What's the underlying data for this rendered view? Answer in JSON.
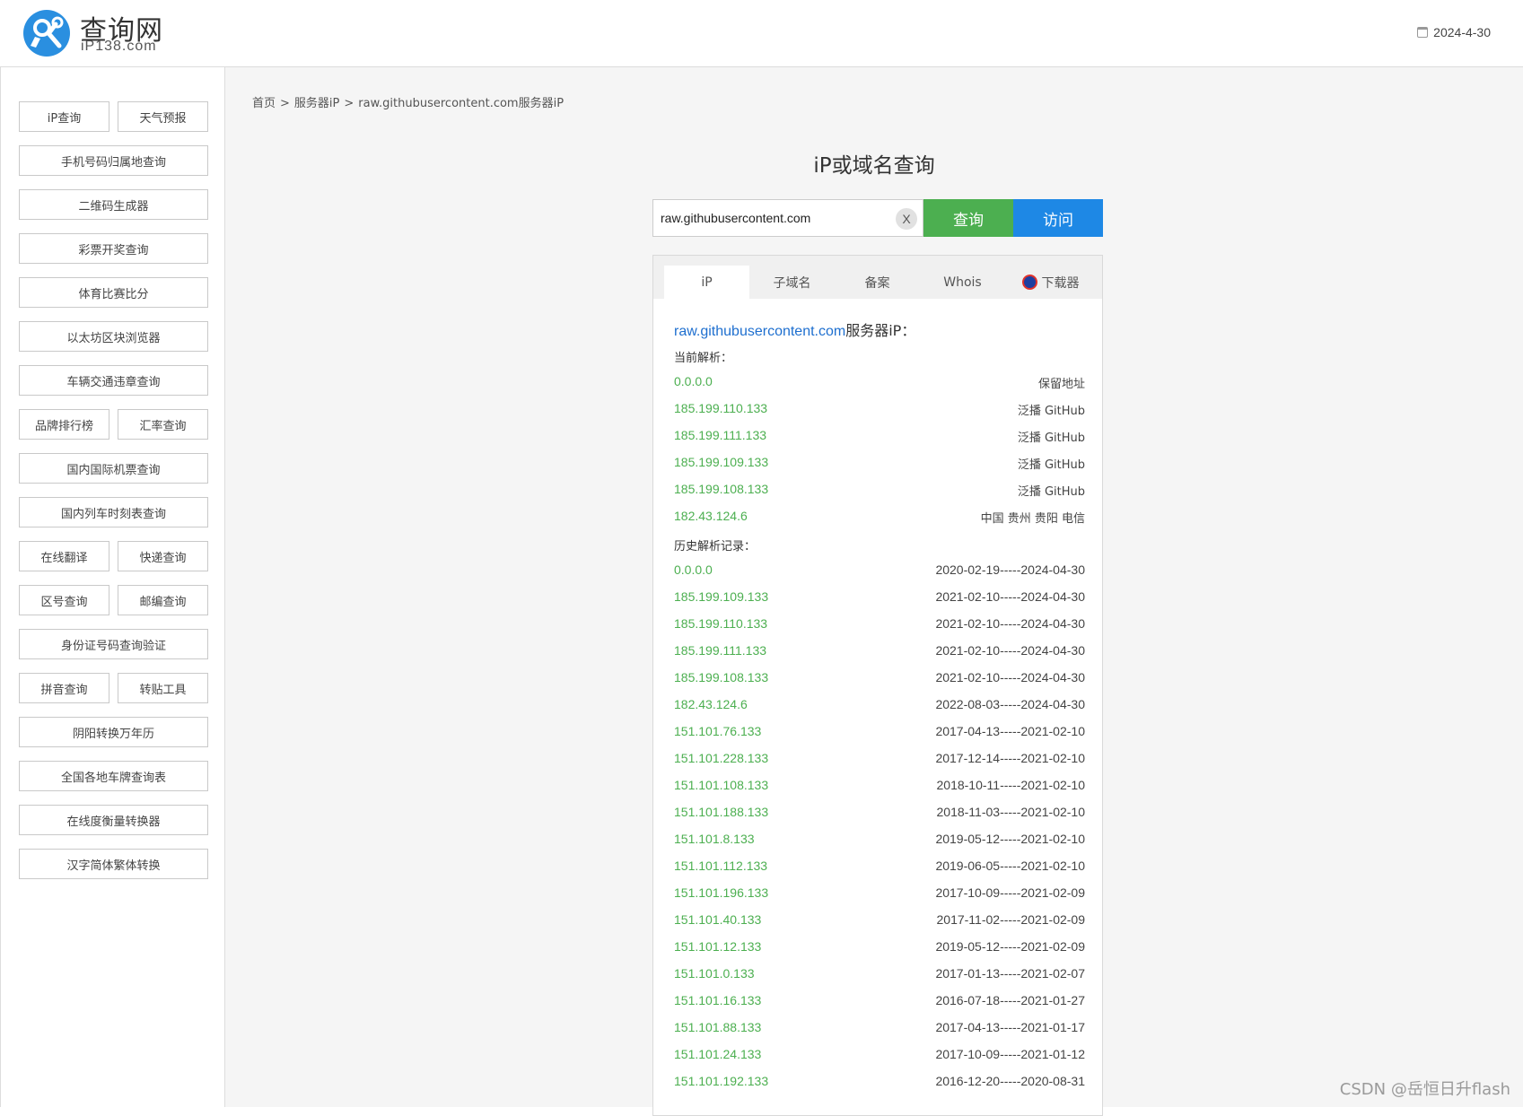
{
  "header": {
    "logo_title": "查询网",
    "logo_sub": "iP138.com",
    "date": "2024-4-30",
    "logo_color": "#2a8fe0"
  },
  "sidebar": {
    "rows": [
      [
        "iP查询",
        "天气预报"
      ],
      [
        "手机号码归属地查询"
      ],
      [
        "二维码生成器"
      ],
      [
        "彩票开奖查询"
      ],
      [
        "体育比赛比分"
      ],
      [
        "以太坊区块浏览器"
      ],
      [
        "车辆交通违章查询"
      ],
      [
        "品牌排行榜",
        "汇率查询"
      ],
      [
        "国内国际机票查询"
      ],
      [
        "国内列车时刻表查询"
      ],
      [
        "在线翻译",
        "快递查询"
      ],
      [
        "区号查询",
        "邮编查询"
      ],
      [
        "身份证号码查询验证"
      ],
      [
        "拼音查询",
        "转贴工具"
      ],
      [
        "阴阳转换万年历"
      ],
      [
        "全国各地车牌查询表"
      ],
      [
        "在线度衡量转换器"
      ],
      [
        "汉字简体繁体转换"
      ]
    ]
  },
  "breadcrumb": {
    "home": "首页",
    "sep": ">",
    "server_ip": "服务器iP",
    "current": "raw.githubusercontent.com服务器iP"
  },
  "search": {
    "title": "iP或域名查询",
    "value": "raw.githubusercontent.com",
    "clear_label": "X",
    "query_label": "查询",
    "visit_label": "访问",
    "query_color": "#4caf50",
    "visit_color": "#1e88e5"
  },
  "tabs": [
    "iP",
    "子域名",
    "备案",
    "Whois",
    "下载器"
  ],
  "result": {
    "domain": "raw.githubusercontent.com",
    "heading_suffix": "服务器iP：",
    "current_label": "当前解析：",
    "current": [
      {
        "ip": "0.0.0.0",
        "info": "保留地址"
      },
      {
        "ip": "185.199.110.133",
        "info": "泛播 GitHub"
      },
      {
        "ip": "185.199.111.133",
        "info": "泛播 GitHub"
      },
      {
        "ip": "185.199.109.133",
        "info": "泛播 GitHub"
      },
      {
        "ip": "185.199.108.133",
        "info": "泛播 GitHub"
      },
      {
        "ip": "182.43.124.6",
        "info": "中国 贵州 贵阳 电信"
      }
    ],
    "history_label": "历史解析记录：",
    "history": [
      {
        "ip": "0.0.0.0",
        "range": "2020-02-19-----2024-04-30"
      },
      {
        "ip": "185.199.109.133",
        "range": "2021-02-10-----2024-04-30"
      },
      {
        "ip": "185.199.110.133",
        "range": "2021-02-10-----2024-04-30"
      },
      {
        "ip": "185.199.111.133",
        "range": "2021-02-10-----2024-04-30"
      },
      {
        "ip": "185.199.108.133",
        "range": "2021-02-10-----2024-04-30"
      },
      {
        "ip": "182.43.124.6",
        "range": "2022-08-03-----2024-04-30"
      },
      {
        "ip": "151.101.76.133",
        "range": "2017-04-13-----2021-02-10"
      },
      {
        "ip": "151.101.228.133",
        "range": "2017-12-14-----2021-02-10"
      },
      {
        "ip": "151.101.108.133",
        "range": "2018-10-11-----2021-02-10"
      },
      {
        "ip": "151.101.188.133",
        "range": "2018-11-03-----2021-02-10"
      },
      {
        "ip": "151.101.8.133",
        "range": "2019-05-12-----2021-02-10"
      },
      {
        "ip": "151.101.112.133",
        "range": "2019-06-05-----2021-02-10"
      },
      {
        "ip": "151.101.196.133",
        "range": "2017-10-09-----2021-02-09"
      },
      {
        "ip": "151.101.40.133",
        "range": "2017-11-02-----2021-02-09"
      },
      {
        "ip": "151.101.12.133",
        "range": "2019-05-12-----2021-02-09"
      },
      {
        "ip": "151.101.0.133",
        "range": "2017-01-13-----2021-02-07"
      },
      {
        "ip": "151.101.16.133",
        "range": "2016-07-18-----2021-01-27"
      },
      {
        "ip": "151.101.88.133",
        "range": "2017-04-13-----2021-01-17"
      },
      {
        "ip": "151.101.24.133",
        "range": "2017-10-09-----2021-01-12"
      },
      {
        "ip": "151.101.192.133",
        "range": "2016-12-20-----2020-08-31"
      }
    ],
    "ip_color": "#4caf50",
    "domain_color": "#1e6fcf"
  },
  "watermark": "CSDN @岳恒日升flash"
}
